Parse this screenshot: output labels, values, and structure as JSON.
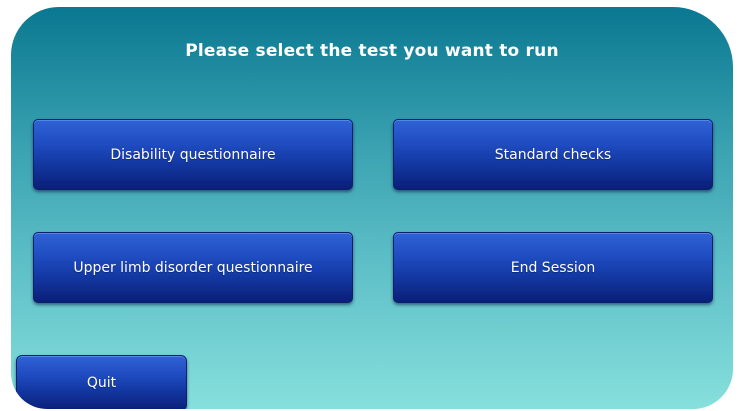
{
  "screen": {
    "title": "Please select the test you want to run"
  },
  "buttons": {
    "disability": "Disability questionnaire",
    "standard": "Standard checks",
    "upper_limb": "Upper limb disorder questionnaire",
    "end_session": "End Session",
    "quit": "Quit"
  },
  "colors": {
    "background_top": "#0a7891",
    "background_bottom": "#86e0dc",
    "button_top": "#2f62d6",
    "button_bottom": "#0a1f78",
    "text": "#ffffff"
  }
}
